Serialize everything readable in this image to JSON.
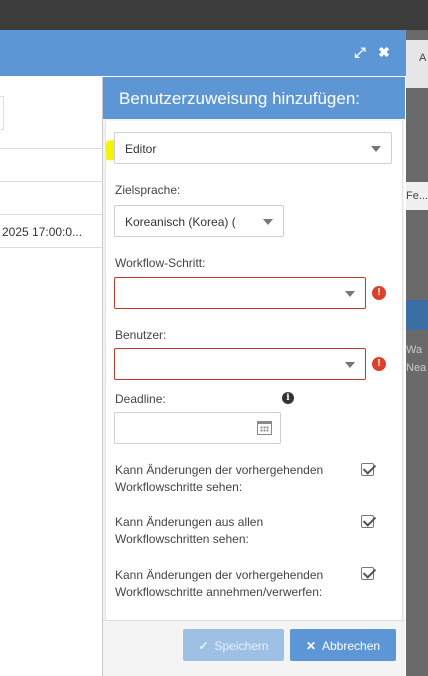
{
  "background": {
    "right_tab_label": "A",
    "right_row_text": "Fe...",
    "right_text_1": "Wa",
    "right_text_2": "Nea"
  },
  "dialog": {
    "row_date": "2025 17:00:0..."
  },
  "panel": {
    "title": "Benutzerzuweisung hinzufügen:",
    "role_select": "Editor",
    "target_language_label": "Zielsprache:",
    "target_language_value": "Koreanisch (Korea) (",
    "workflow_step_label": "Workflow-Schritt:",
    "workflow_step_value": "",
    "user_label": "Benutzer:",
    "user_value": "",
    "deadline_label": "Deadline:",
    "deadline_value": "",
    "checkboxes": [
      {
        "label": "Kann Änderungen der vorhergehenden Workflowschritte sehen:",
        "checked": true
      },
      {
        "label": "Kann Änderungen aus allen Workflowschritten sehen:",
        "checked": true
      },
      {
        "label": "Kann Änderungen der vorhergehenden Workflowschritte annehmen/verwerfen:",
        "checked": true
      }
    ],
    "save_label": "Speichern",
    "cancel_label": "Abbrechen"
  },
  "colors": {
    "header_blue": "#5d96d4",
    "error_red": "#d9412b",
    "highlight_yellow": "#f5f30a"
  }
}
